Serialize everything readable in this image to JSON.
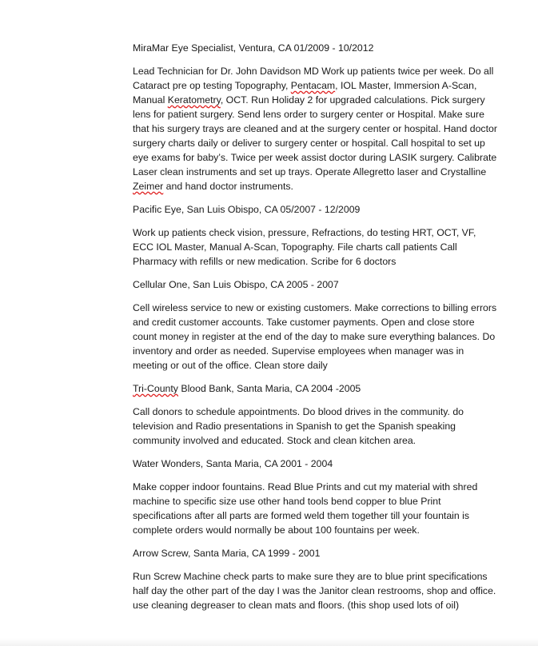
{
  "entries": [
    {
      "heading": "MiraMar Eye Specialist, Ventura, CA 01/2009 - 10/2012",
      "description": {
        "p1": "Lead Technician for Dr. John Davidson MD Work up patients twice per week. Do all Cataract pre op testing Topography, ",
        "s1": "Pentacam",
        "p2": ", IOL Master, Immersion A-Scan, Manual ",
        "s2": "Keratometry",
        "p3": ", OCT. Run Holiday 2 for upgraded calculations. Pick surgery lens for patient surgery. Send lens order to surgery center or Hospital. Make sure that his surgery trays are cleaned and at the surgery center or hospital. Hand doctor surgery charts daily or deliver to surgery center or hospital. Call hospital to set up eye exams for baby’s. Twice per week assist doctor during LASIK surgery. Calibrate Laser clean instruments and set up trays. Operate Allegretto laser and Crystalline ",
        "s3": "Zeimer",
        "p4": " and hand doctor instruments."
      }
    },
    {
      "heading": "Pacific Eye, San Luis Obispo, CA 05/2007 - 12/2009",
      "description": "Work up patients check vision,  pressure, Refractions, do testing HRT, OCT, VF, ECC IOL Master, Manual A-Scan, Topography. File charts call patients Call Pharmacy with refills or new medication. Scribe for 6 doctors"
    },
    {
      "heading": "Cellular One, San Luis Obispo, CA 2005 - 2007",
      "description": "Cell wireless service to new or existing customers. Make corrections to billing errors and credit customer accounts. Take customer payments. Open and close store count money in register at the end of the day to make sure everything balances. Do inventory and order as needed. Supervise employees when manager was in meeting or out of the office. Clean store daily"
    },
    {
      "heading_spell": "Tri-County",
      "heading_rest": " Blood Bank, Santa Maria, CA 2004 -2005",
      "description": "Call donors to schedule appointments. Do blood drives in the community. do television and Radio presentations in Spanish to get the Spanish speaking community involved and educated. Stock and clean kitchen area."
    },
    {
      "heading": "Water Wonders, Santa Maria, CA 2001 - 2004",
      "description": "Make copper indoor fountains. Read Blue Prints and cut my material with shred machine to specific size use other hand tools bend copper to blue Print specifications after all parts are formed weld them together till your fountain is complete orders would normally be about 100 fountains per week."
    },
    {
      "heading": "Arrow Screw, Santa Maria, CA  1999 - 2001",
      "description": "Run Screw Machine check parts to make sure they are to blue print specifications half day the other part of the day I was the Janitor clean restrooms, shop and office. use cleaning degreaser to clean mats and floors. (this shop used lots of oil)"
    }
  ]
}
